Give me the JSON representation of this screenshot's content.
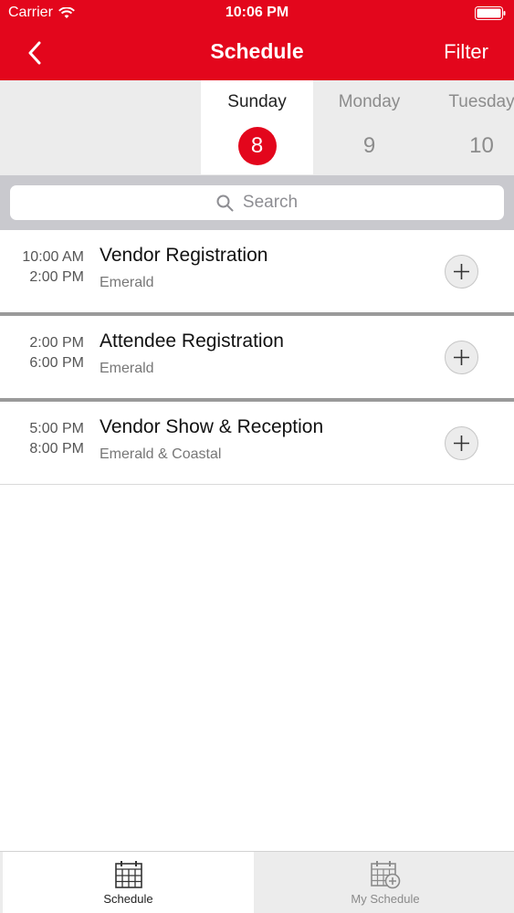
{
  "status_bar": {
    "carrier": "Carrier",
    "time": "10:06 PM"
  },
  "nav": {
    "title": "Schedule",
    "filter_label": "Filter",
    "back_icon": "chevron-left-icon"
  },
  "days": [
    {
      "name": "Sunday",
      "number": "8",
      "selected": true
    },
    {
      "name": "Monday",
      "number": "9",
      "selected": false
    },
    {
      "name": "Tuesday",
      "number": "10",
      "selected": false
    }
  ],
  "search": {
    "placeholder": "Search"
  },
  "events": [
    {
      "start": "10:00 AM",
      "end": "2:00 PM",
      "title": "Vendor Registration",
      "location": "Emerald"
    },
    {
      "start": "2:00 PM",
      "end": "6:00 PM",
      "title": "Attendee Registration",
      "location": "Emerald"
    },
    {
      "start": "5:00 PM",
      "end": "8:00 PM",
      "title": "Vendor Show & Reception",
      "location": "Emerald & Coastal"
    }
  ],
  "tabs": [
    {
      "label": "Schedule",
      "icon": "calendar-grid-icon",
      "selected": true
    },
    {
      "label": "My Schedule",
      "icon": "calendar-add-icon",
      "selected": false
    }
  ],
  "colors": {
    "accent": "#e3061c",
    "strip": "#ececec",
    "search_bg": "#c9c9ce"
  }
}
